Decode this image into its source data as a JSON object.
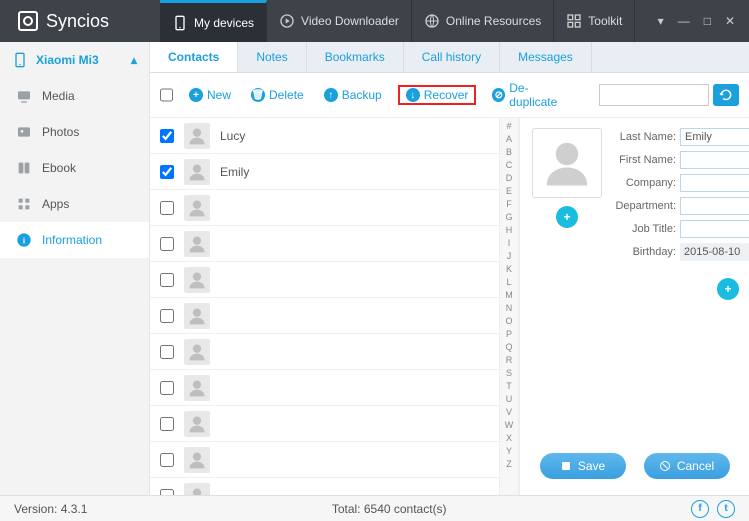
{
  "app": {
    "title": "Syncios"
  },
  "topTabs": [
    {
      "label": "My devices"
    },
    {
      "label": "Video Downloader"
    },
    {
      "label": "Online Resources"
    },
    {
      "label": "Toolkit"
    }
  ],
  "device": {
    "name": "Xiaomi Mi3"
  },
  "sidebar": [
    {
      "label": "Media"
    },
    {
      "label": "Photos"
    },
    {
      "label": "Ebook"
    },
    {
      "label": "Apps"
    },
    {
      "label": "Information"
    }
  ],
  "tabs2": [
    {
      "label": "Contacts"
    },
    {
      "label": "Notes"
    },
    {
      "label": "Bookmarks"
    },
    {
      "label": "Call history"
    },
    {
      "label": "Messages"
    }
  ],
  "toolbar": {
    "new": "New",
    "delete": "Delete",
    "backup": "Backup",
    "recover": "Recover",
    "dedup": "De-duplicate"
  },
  "contacts": [
    {
      "name": "Lucy",
      "checked": true
    },
    {
      "name": "Emily",
      "checked": true
    },
    {
      "name": "",
      "checked": false
    },
    {
      "name": "",
      "checked": false
    },
    {
      "name": "",
      "checked": false
    },
    {
      "name": "",
      "checked": false
    },
    {
      "name": "",
      "checked": false
    },
    {
      "name": "",
      "checked": false
    },
    {
      "name": "",
      "checked": false
    },
    {
      "name": "",
      "checked": false
    },
    {
      "name": "",
      "checked": false
    }
  ],
  "detail": {
    "labels": {
      "lastName": "Last Name:",
      "firstName": "First Name:",
      "company": "Company:",
      "department": "Department:",
      "jobTitle": "Job Title:",
      "birthday": "Birthday:"
    },
    "values": {
      "lastName": "Emily",
      "firstName": "",
      "company": "",
      "department": "",
      "jobTitle": "",
      "birthday": "2015-08-10"
    },
    "save": "Save",
    "cancel": "Cancel"
  },
  "az": [
    "#",
    "A",
    "B",
    "C",
    "D",
    "E",
    "F",
    "G",
    "H",
    "I",
    "J",
    "K",
    "L",
    "M",
    "N",
    "O",
    "P",
    "Q",
    "R",
    "S",
    "T",
    "U",
    "V",
    "W",
    "X",
    "Y",
    "Z"
  ],
  "status": {
    "version": "Version: 4.3.1",
    "total": "Total: 6540 contact(s)"
  }
}
